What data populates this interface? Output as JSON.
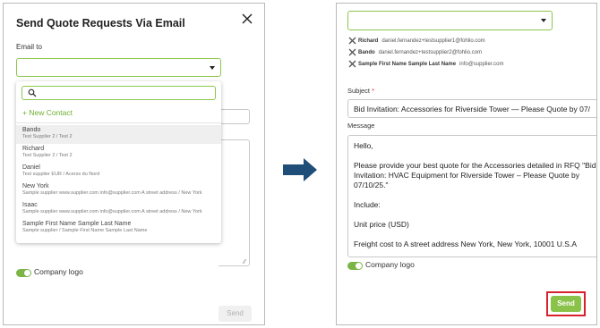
{
  "left_panel": {
    "title": "Send Quote Requests Via Email",
    "email_label": "Email to",
    "dropdown": {
      "new_contact": "+ New Contact",
      "contacts": [
        {
          "name": "Bando",
          "detail": "Test Supplier 2 / Test 2"
        },
        {
          "name": "Richard",
          "detail": "Test Supplier 2 / Test 2"
        },
        {
          "name": "Daniel",
          "detail": "Test supplier EUR / Acerss du Nord"
        },
        {
          "name": "New York",
          "detail": "Sample supplier www.supplier.com info@supplier.com A street address / New York"
        },
        {
          "name": "Isaac",
          "detail": "Sample supplier www.supplier.com info@supplier.com A street address / New York"
        },
        {
          "name": "Sample First Name Sample Last Name",
          "detail": "Sample supplier / Sample First Name Sample Last Name"
        }
      ]
    },
    "company_logo_label": "Company logo",
    "send_label": "Send"
  },
  "right_panel": {
    "recipients": [
      {
        "name": "Richard",
        "email": "daniel.fernandez+testsupplier1@fohlio.com"
      },
      {
        "name": "Bando",
        "email": "daniel.fernandez+testsupplier2@fohlio.com"
      },
      {
        "name": "Sample First Name Sample Last Name",
        "email": "info@supplier.com"
      }
    ],
    "subject_label": "Subject",
    "required_mark": "*",
    "subject_value": "Bid Invitation: Accessories for Riverside Tower — Please Quote by 07/",
    "message_label": "Message",
    "message_lines": [
      "Hello,",
      "Please provide your best quote for the Accessories detailed in RFQ \"Bid Invitation: HVAC Equipment for Riverside Tower – Please Quote by 07/10/25.\"",
      "Include:",
      "Unit price (USD)",
      "Freight cost to A street address New York, New York, 10001 U.S.A"
    ],
    "company_logo_label": "Company logo",
    "send_label": "Send"
  },
  "colors": {
    "accent_green": "#8bc34a",
    "highlight_red": "#d9212b",
    "arrow_blue": "#1f4e79"
  }
}
